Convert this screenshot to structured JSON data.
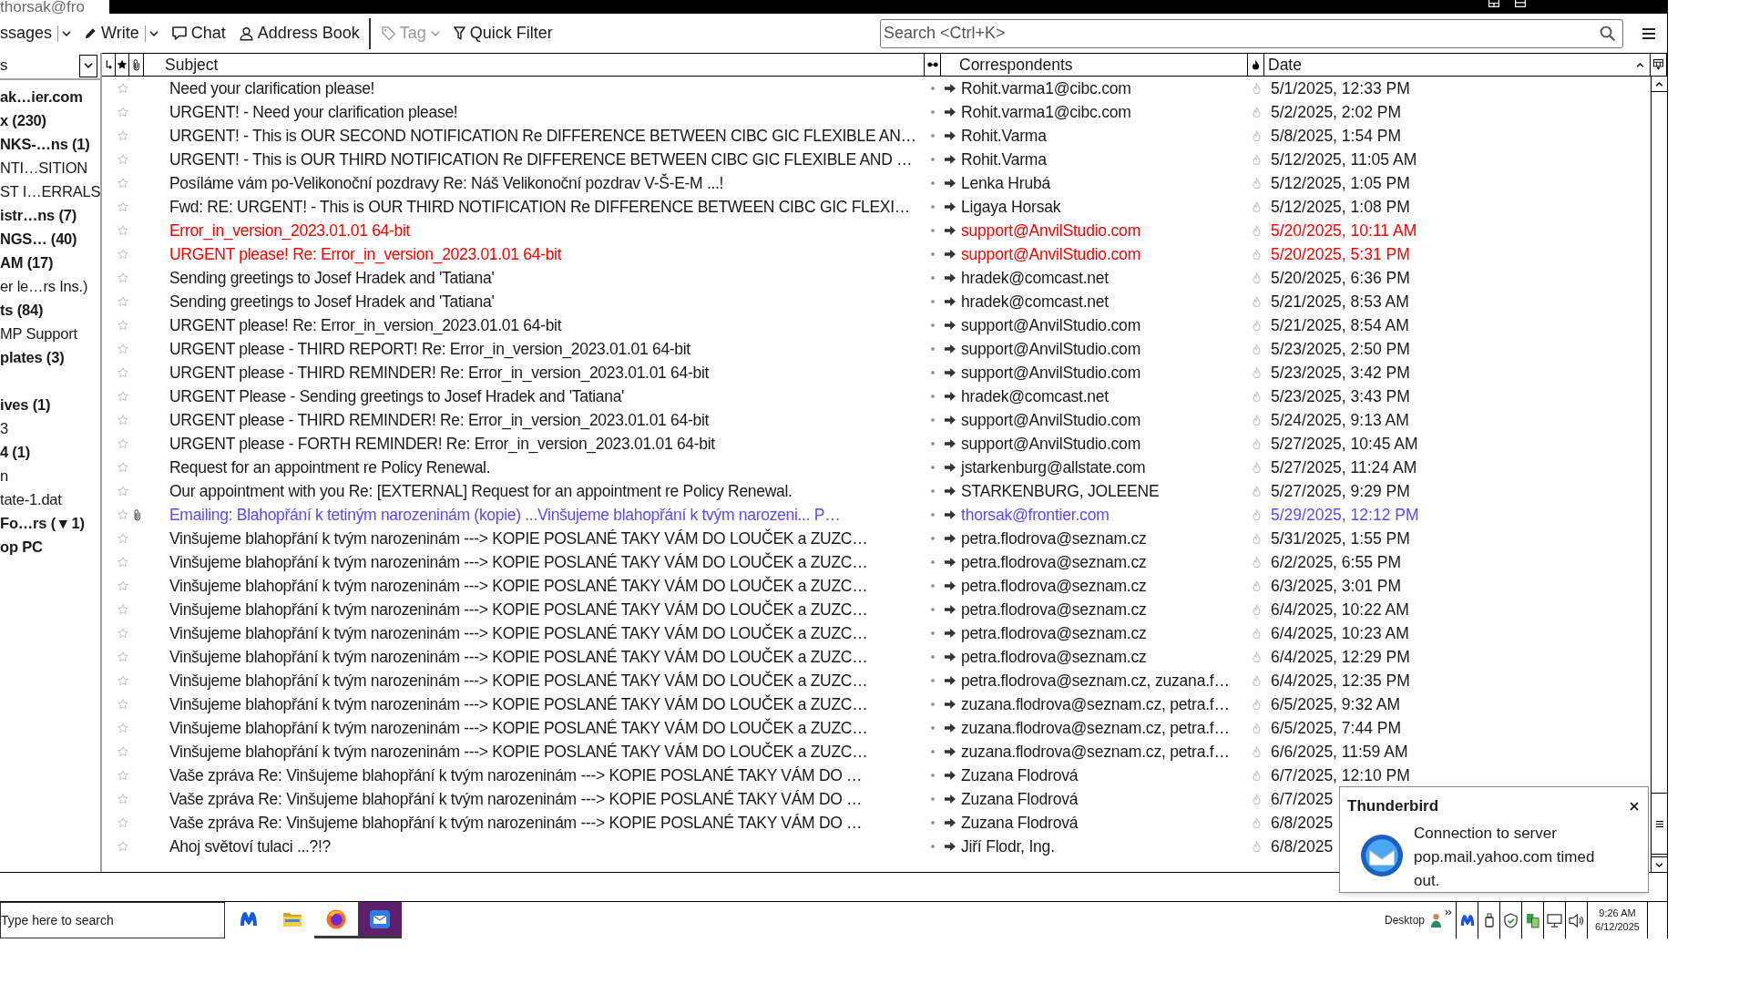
{
  "window": {
    "tab_title": "thorsak@fro"
  },
  "toolbar": {
    "groups": [
      {
        "buttons": [
          {
            "kind": "get",
            "label": "ssages",
            "dropdown": true,
            "split": true,
            "disabled": false
          },
          {
            "kind": "write",
            "label": "Write",
            "dropdown": true,
            "split": true,
            "disabled": false
          },
          {
            "kind": "chat",
            "label": "Chat",
            "dropdown": false,
            "disabled": false
          },
          {
            "kind": "address",
            "label": "Address Book",
            "dropdown": false,
            "disabled": false
          }
        ]
      },
      {
        "buttons": [
          {
            "kind": "tag",
            "label": "Tag",
            "dropdown": true,
            "disabled": true
          },
          {
            "kind": "filter",
            "label": "Quick Filter",
            "dropdown": false,
            "disabled": false
          }
        ]
      }
    ],
    "search": {
      "placeholder": "Search <Ctrl+K>"
    }
  },
  "folder_pane": {
    "header": "s",
    "groups": [
      {
        "folders": [
          {
            "label": "ak…ier.com",
            "unread": true
          },
          {
            "label": "x (230)",
            "unread": true
          },
          {
            "label": "NKS-…ns (1)",
            "unread": true
          },
          {
            "label": "NTI…SITION",
            "unread": false
          },
          {
            "label": "ST I…ERRALS",
            "unread": false
          },
          {
            "label": "istr…ns (7)",
            "unread": true
          },
          {
            "label": "NGS… (40)",
            "unread": true
          },
          {
            "label": "AM (17)",
            "unread": true
          },
          {
            "label": "er le…rs Ins.)",
            "unread": false
          },
          {
            "label": "ts (84)",
            "unread": true
          },
          {
            "label": "MP Support",
            "unread": false
          },
          {
            "label": "plates (3)",
            "unread": true
          }
        ]
      },
      {
        "folders": [
          {
            "label": "ives (1)",
            "unread": true
          },
          {
            "label": "3",
            "unread": false
          },
          {
            "label": "4 (1)",
            "unread": true
          },
          {
            "label": "n",
            "unread": false
          },
          {
            "label": "tate-1.dat",
            "unread": false
          },
          {
            "label": "Fo…rs ( ▾ 1)",
            "unread": true
          },
          {
            "label": "op PC",
            "unread": true
          }
        ]
      }
    ]
  },
  "message_list": {
    "columns": [
      {
        "label": "Subject",
        "sorted": false
      },
      {
        "label": "Correspondents",
        "sorted": false
      },
      {
        "label": "Date",
        "sorted": true
      }
    ],
    "sort_ascending": true,
    "rows": [
      {
        "subject": "Need your clarification please!",
        "correspondent": "Rohit.varma1@cibc.com",
        "date": "5/1/2025, 12:33 PM",
        "color": "#1a1a1a",
        "starred": false,
        "attachment": false,
        "read": true,
        "outgoing": true,
        "junk": false
      },
      {
        "subject": "URGENT! - Need your clarification please!",
        "correspondent": "Rohit.varma1@cibc.com",
        "date": "5/2/2025, 2:02 PM",
        "color": "#1a1a1a",
        "starred": false,
        "attachment": false,
        "read": true,
        "outgoing": true,
        "junk": false
      },
      {
        "subject": "URGENT! - This is OUR SECOND NOTIFICATION Re DIFFERENCE BETWEEN CIBC GIC FLEXIBLE AN…",
        "correspondent": "Rohit.Varma",
        "date": "5/8/2025, 1:54 PM",
        "color": "#1a1a1a",
        "starred": false,
        "attachment": false,
        "read": true,
        "outgoing": true,
        "junk": false
      },
      {
        "subject": "URGENT! - This is OUR THIRD NOTIFICATION Re DIFFERENCE BETWEEN CIBC GIC FLEXIBLE AND …",
        "correspondent": "Rohit.Varma",
        "date": "5/12/2025, 11:05 AM",
        "color": "#1a1a1a",
        "starred": false,
        "attachment": false,
        "read": true,
        "outgoing": true,
        "junk": false
      },
      {
        "subject": "Posíláme vám po-Velikonoční pozdravy Re: Náš Velikonoční pozdrav V-Š-E-M ...!",
        "correspondent": "Lenka Hrubá",
        "date": "5/12/2025, 1:05 PM",
        "color": "#1a1a1a",
        "starred": false,
        "attachment": false,
        "read": true,
        "outgoing": true,
        "junk": false
      },
      {
        "subject": "Fwd: RE: URGENT! - This is OUR THIRD NOTIFICATION Re DIFFERENCE BETWEEN CIBC GIC FLEXI…",
        "correspondent": "Ligaya Horsak",
        "date": "5/12/2025, 1:08 PM",
        "color": "#1a1a1a",
        "starred": false,
        "attachment": false,
        "read": true,
        "outgoing": true,
        "junk": false
      },
      {
        "subject": "Error_in_version_2023.01.01 64-bit",
        "correspondent": "support@AnvilStudio.com",
        "date": "5/20/2025, 10:11 AM",
        "color": "#ff0000",
        "starred": false,
        "attachment": false,
        "read": true,
        "outgoing": true,
        "junk": false
      },
      {
        "subject": "URGENT please! Re: Error_in_version_2023.01.01 64-bit",
        "correspondent": "support@AnvilStudio.com",
        "date": "5/20/2025, 5:31 PM",
        "color": "#ff0000",
        "starred": false,
        "attachment": false,
        "read": true,
        "outgoing": true,
        "junk": false
      },
      {
        "subject": "Sending greetings to Josef Hradek and 'Tatiana'",
        "correspondent": "hradek@comcast.net",
        "date": "5/20/2025, 6:36 PM",
        "color": "#1a1a1a",
        "starred": false,
        "attachment": false,
        "read": true,
        "outgoing": true,
        "junk": false
      },
      {
        "subject": "Sending greetings to Josef Hradek and 'Tatiana'",
        "correspondent": "hradek@comcast.net",
        "date": "5/21/2025, 8:53 AM",
        "color": "#1a1a1a",
        "starred": false,
        "attachment": false,
        "read": true,
        "outgoing": true,
        "junk": false
      },
      {
        "subject": "URGENT please! Re: Error_in_version_2023.01.01 64-bit",
        "correspondent": "support@AnvilStudio.com",
        "date": "5/21/2025, 8:54 AM",
        "color": "#1a1a1a",
        "starred": false,
        "attachment": false,
        "read": true,
        "outgoing": true,
        "junk": false
      },
      {
        "subject": "URGENT please - THIRD REPORT! Re: Error_in_version_2023.01.01 64-bit",
        "correspondent": "support@AnvilStudio.com",
        "date": "5/23/2025, 2:50 PM",
        "color": "#1a1a1a",
        "starred": false,
        "attachment": false,
        "read": true,
        "outgoing": true,
        "junk": false
      },
      {
        "subject": "URGENT please - THIRD REMINDER! Re: Error_in_version_2023.01.01 64-bit",
        "correspondent": "support@AnvilStudio.com",
        "date": "5/23/2025, 3:42 PM",
        "color": "#1a1a1a",
        "starred": false,
        "attachment": false,
        "read": true,
        "outgoing": true,
        "junk": false
      },
      {
        "subject": "URGENT Please - Sending greetings to Josef Hradek and 'Tatiana'",
        "correspondent": "hradek@comcast.net",
        "date": "5/23/2025, 3:43 PM",
        "color": "#1a1a1a",
        "starred": false,
        "attachment": false,
        "read": true,
        "outgoing": true,
        "junk": false
      },
      {
        "subject": "URGENT please - THIRD REMINDER! Re: Error_in_version_2023.01.01 64-bit",
        "correspondent": "support@AnvilStudio.com",
        "date": "5/24/2025, 9:13 AM",
        "color": "#1a1a1a",
        "starred": false,
        "attachment": false,
        "read": true,
        "outgoing": true,
        "junk": false
      },
      {
        "subject": "URGENT please - FORTH REMINDER! Re: Error_in_version_2023.01.01 64-bit",
        "correspondent": "support@AnvilStudio.com",
        "date": "5/27/2025, 10:45 AM",
        "color": "#1a1a1a",
        "starred": false,
        "attachment": false,
        "read": true,
        "outgoing": true,
        "junk": false
      },
      {
        "subject": "Request for an appointment re Policy Renewal.",
        "correspondent": "jstarkenburg@allstate.com",
        "date": "5/27/2025, 11:24 AM",
        "color": "#1a1a1a",
        "starred": false,
        "attachment": false,
        "read": true,
        "outgoing": true,
        "junk": false
      },
      {
        "subject": "Our appointment with you Re: [EXTERNAL] Request for an appointment re Policy Renewal.",
        "correspondent": "STARKENBURG, JOLEENE",
        "date": "5/27/2025, 9:29 PM",
        "color": "#1a1a1a",
        "starred": false,
        "attachment": false,
        "read": true,
        "outgoing": true,
        "junk": false
      },
      {
        "subject": "Emailing: Blahopřání k tetiným narozeninám (kopie) ...Vinšujeme blahopřání k tvým narozeni... P…",
        "correspondent": "thorsak@frontier.com",
        "date": "5/29/2025, 12:12 PM",
        "color": "#5b4bff",
        "starred": false,
        "attachment": true,
        "read": true,
        "outgoing": true,
        "junk": false
      },
      {
        "subject": "Vinšujeme blahopřání k tvým narozeninám ---> KOPIE POSLANÉ TAKY VÁM DO LOUČEK a ZUZC…",
        "correspondent": "petra.flodrova@seznam.cz",
        "date": "5/31/2025, 1:55 PM",
        "color": "#1a1a1a",
        "starred": false,
        "attachment": false,
        "read": true,
        "outgoing": true,
        "junk": false
      },
      {
        "subject": "Vinšujeme blahopřání k tvým narozeninám ---> KOPIE POSLANÉ TAKY VÁM DO LOUČEK a ZUZC…",
        "correspondent": "petra.flodrova@seznam.cz",
        "date": "6/2/2025, 6:55 PM",
        "color": "#1a1a1a",
        "starred": false,
        "attachment": false,
        "read": true,
        "outgoing": true,
        "junk": false
      },
      {
        "subject": "Vinšujeme blahopřání k tvým narozeninám ---> KOPIE POSLANÉ TAKY VÁM DO LOUČEK a ZUZC…",
        "correspondent": "petra.flodrova@seznam.cz",
        "date": "6/3/2025, 3:01 PM",
        "color": "#1a1a1a",
        "starred": false,
        "attachment": false,
        "read": true,
        "outgoing": true,
        "junk": false
      },
      {
        "subject": "Vinšujeme blahopřání k tvým narozeninám ---> KOPIE POSLANÉ TAKY VÁM DO LOUČEK a ZUZC…",
        "correspondent": "petra.flodrova@seznam.cz",
        "date": "6/4/2025, 10:22 AM",
        "color": "#1a1a1a",
        "starred": false,
        "attachment": false,
        "read": true,
        "outgoing": true,
        "junk": false
      },
      {
        "subject": "Vinšujeme blahopřání k tvým narozeninám ---> KOPIE POSLANÉ TAKY VÁM DO LOUČEK a ZUZC…",
        "correspondent": "petra.flodrova@seznam.cz",
        "date": "6/4/2025, 10:23 AM",
        "color": "#1a1a1a",
        "starred": false,
        "attachment": false,
        "read": true,
        "outgoing": true,
        "junk": false
      },
      {
        "subject": "Vinšujeme blahopřání k tvým narozeninám ---> KOPIE POSLANÉ TAKY VÁM DO LOUČEK a ZUZC…",
        "correspondent": "petra.flodrova@seznam.cz",
        "date": "6/4/2025, 12:29 PM",
        "color": "#1a1a1a",
        "starred": false,
        "attachment": false,
        "read": true,
        "outgoing": true,
        "junk": false
      },
      {
        "subject": "Vinšujeme blahopřání k tvým narozeninám ---> KOPIE POSLANÉ TAKY VÁM DO LOUČEK a ZUZC…",
        "correspondent": "petra.flodrova@seznam.cz, zuzana.f…",
        "date": "6/4/2025, 12:35 PM",
        "color": "#1a1a1a",
        "starred": false,
        "attachment": false,
        "read": true,
        "outgoing": true,
        "junk": false
      },
      {
        "subject": "Vinšujeme blahopřání k tvým narozeninám ---> KOPIE POSLANÉ TAKY VÁM DO LOUČEK a ZUZC…",
        "correspondent": "zuzana.flodrova@seznam.cz, petra.f…",
        "date": "6/5/2025, 9:32 AM",
        "color": "#1a1a1a",
        "starred": false,
        "attachment": false,
        "read": true,
        "outgoing": true,
        "junk": false
      },
      {
        "subject": "Vinšujeme blahopřání k tvým narozeninám ---> KOPIE POSLANÉ TAKY VÁM DO LOUČEK a ZUZC…",
        "correspondent": "zuzana.flodrova@seznam.cz, petra.f…",
        "date": "6/5/2025, 7:44 PM",
        "color": "#1a1a1a",
        "starred": false,
        "attachment": false,
        "read": true,
        "outgoing": true,
        "junk": false
      },
      {
        "subject": "Vinšujeme blahopřání k tvým narozeninám ---> KOPIE POSLANÉ TAKY VÁM DO LOUČEK a ZUZC…",
        "correspondent": "zuzana.flodrova@seznam.cz, petra.f…",
        "date": "6/6/2025, 11:59 AM",
        "color": "#1a1a1a",
        "starred": false,
        "attachment": false,
        "read": true,
        "outgoing": true,
        "junk": false
      },
      {
        "subject": "Vaše zpráva Re: Vinšujeme blahopřání k tvým narozeninám ---> KOPIE POSLANÉ TAKY VÁM DO …",
        "correspondent": "Zuzana Flodrová",
        "date": "6/7/2025, 12:10 PM",
        "color": "#1a1a1a",
        "starred": false,
        "attachment": false,
        "read": true,
        "outgoing": true,
        "junk": false
      },
      {
        "subject": "Vaše zpráva Re: Vinšujeme blahopřání k tvým narozeninám ---> KOPIE POSLANÉ TAKY VÁM DO …",
        "correspondent": "Zuzana Flodrová",
        "date": "6/7/2025",
        "color": "#1a1a1a",
        "starred": false,
        "attachment": false,
        "read": true,
        "outgoing": true,
        "junk": false
      },
      {
        "subject": "Vaše zpráva Re: Vinšujeme blahopřání k tvým narozeninám ---> KOPIE POSLANÉ TAKY VÁM DO …",
        "correspondent": "Zuzana Flodrová",
        "date": "6/8/2025",
        "color": "#1a1a1a",
        "starred": false,
        "attachment": false,
        "read": true,
        "outgoing": true,
        "junk": false
      },
      {
        "subject": "Ahoj světoví tulaci ...?!?",
        "correspondent": "Jiří Flodr, Ing.",
        "date": "6/8/2025",
        "color": "#1a1a1a",
        "starred": false,
        "attachment": false,
        "read": true,
        "outgoing": true,
        "junk": false
      }
    ]
  },
  "notification": {
    "title": "Thunderbird",
    "message": "Connection to server pop.mail.yahoo.com timed out."
  },
  "taskbar": {
    "search": {
      "placeholder": "Type here to search"
    },
    "apps": [
      {
        "kind": "m-logo",
        "running": false,
        "active": false
      },
      {
        "kind": "folder",
        "running": false,
        "active": false
      },
      {
        "kind": "ring",
        "running": true,
        "active": false
      },
      {
        "kind": "envelope",
        "running": true,
        "active": true
      }
    ],
    "tray": {
      "label": "Desktop"
    },
    "clock": {
      "time": "9:26 AM",
      "date": "6/12/2025"
    }
  }
}
